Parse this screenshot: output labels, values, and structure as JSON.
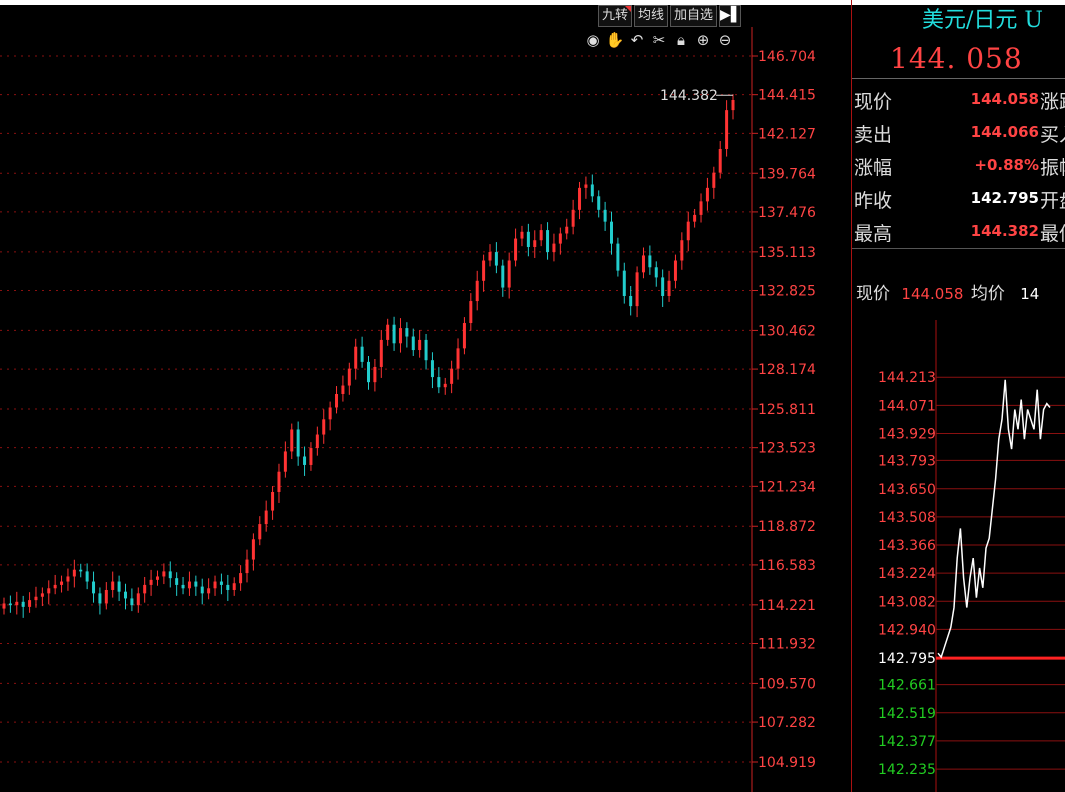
{
  "toolbar": {
    "tabs": [
      "九转",
      "均线",
      "加自选"
    ],
    "arrow_label": "▶▌",
    "icons": [
      "eye-icon",
      "hand-icon",
      "undo-icon",
      "scissors-icon",
      "lock-icon",
      "zoom-in-icon",
      "zoom-out-icon"
    ]
  },
  "panel": {
    "title": "美元/日元 U",
    "price": "144. 058",
    "quote_rows": [
      {
        "label": "现价",
        "value": "144.058",
        "tail": "涨跌",
        "color": "#ff4444"
      },
      {
        "label": "卖出",
        "value": "144.066",
        "tail": "买入",
        "color": "#ff4444"
      },
      {
        "label": "涨幅",
        "value": "+0.88%",
        "tail": "振幅",
        "color": "#ff4444"
      },
      {
        "label": "昨收",
        "value": "142.795",
        "tail": "开盘",
        "color": "#ffffff"
      },
      {
        "label": "最高",
        "value": "144.382",
        "tail": "最低",
        "color": "#ff4444"
      }
    ],
    "intraday_header": {
      "label1": "现价",
      "value1": "144.058",
      "label2": "均价",
      "value2": "14"
    }
  },
  "colors": {
    "up": "#ff3333",
    "down": "#22cccc",
    "grid": "#8a1010",
    "axis": "#cc2222"
  },
  "chart_data": [
    {
      "type": "candlestick",
      "title": "",
      "y_ticks": [
        146.704,
        144.415,
        142.127,
        139.764,
        137.476,
        135.113,
        132.825,
        130.462,
        128.174,
        125.811,
        123.523,
        121.234,
        118.872,
        116.583,
        114.221,
        111.932,
        109.57,
        107.282,
        104.919
      ],
      "ylim": [
        104.919,
        146.704
      ],
      "high_annotation": "144.382",
      "close_series": [
        114.3,
        114.2,
        114.4,
        114.1,
        114.5,
        114.7,
        114.9,
        115.2,
        115.4,
        115.6,
        115.9,
        116.3,
        116.2,
        115.6,
        114.9,
        114.3,
        115.1,
        115.6,
        115.0,
        114.6,
        114.2,
        114.9,
        115.4,
        115.7,
        115.9,
        116.2,
        115.8,
        115.4,
        115.2,
        115.6,
        115.3,
        114.9,
        115.2,
        115.6,
        115.4,
        115.1,
        115.5,
        116.1,
        116.9,
        118.1,
        119.0,
        119.8,
        120.9,
        122.1,
        123.3,
        124.6,
        123.0,
        122.5,
        123.5,
        124.3,
        125.2,
        125.9,
        126.7,
        127.2,
        128.2,
        129.5,
        128.6,
        127.4,
        128.3,
        129.9,
        130.8,
        129.7,
        130.6,
        130.1,
        129.3,
        129.9,
        128.7,
        127.7,
        127.1,
        127.3,
        128.2,
        129.4,
        130.9,
        132.2,
        133.4,
        134.6,
        135.1,
        134.3,
        133.0,
        134.6,
        135.9,
        136.3,
        135.4,
        135.8,
        136.4,
        135.1,
        135.6,
        136.2,
        136.6,
        137.6,
        138.9,
        139.1,
        138.4,
        137.6,
        136.9,
        135.6,
        134.0,
        132.5,
        131.9,
        133.9,
        134.9,
        134.2,
        133.6,
        132.5,
        133.4,
        134.6,
        135.8,
        136.9,
        137.3,
        138.1,
        138.9,
        139.8,
        141.2,
        143.5,
        144.1
      ]
    },
    {
      "type": "line",
      "title": "",
      "y_ticks": [
        144.213,
        144.071,
        143.929,
        143.793,
        143.65,
        143.508,
        143.366,
        143.224,
        143.082,
        142.94,
        142.795,
        142.661,
        142.519,
        142.377,
        142.235
      ],
      "prev_close": 142.795,
      "prev_close_label": "142.795",
      "ylim": [
        142.2,
        144.3
      ],
      "values": [
        142.82,
        142.8,
        142.85,
        142.9,
        142.95,
        143.05,
        143.3,
        143.45,
        143.2,
        143.05,
        143.2,
        143.3,
        143.1,
        143.25,
        143.15,
        143.35,
        143.4,
        143.55,
        143.7,
        143.9,
        144.0,
        144.2,
        143.95,
        143.85,
        144.05,
        143.95,
        144.1,
        143.9,
        144.05,
        144.0,
        143.95,
        144.15,
        143.9,
        144.05,
        144.08,
        144.06
      ]
    }
  ]
}
